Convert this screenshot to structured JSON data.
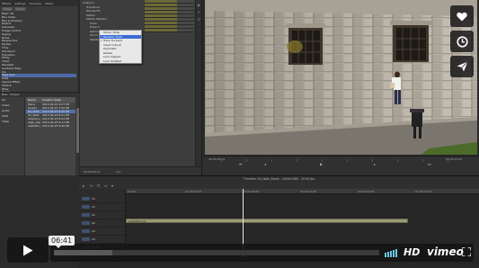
{
  "left_panel": {
    "tabs": [
      "Effects",
      "Settings",
      "Favorites",
      "Media"
    ],
    "search": [
      "Video",
      "Audio"
    ],
    "effects": [
      "Basic 3D",
      "Blur Video",
      "Blur & Sharpen",
      "Distort",
      "Generate",
      "Image Control",
      "Keying",
      "Noise",
      "Perspective",
      "Stylize",
      "Time",
      "Transform",
      "Transition",
      "Utility",
      "Video",
      "Obsolete",
      "Gradient Wipe",
      "Iris",
      "Page Peel",
      "Slide",
      "Special Effect",
      "Stretch",
      "Wipe",
      "Zoom",
      "Frame Blend",
      "Lumetri Presets",
      "Presets",
      "Film Stock",
      "Cinematic",
      "Desaturation",
      "Speed Looks",
      "Temperature",
      "Technical",
      "Color Correction",
      "Adjust",
      "Lens Distortion"
    ],
    "bins": {
      "tabs": [
        "Bins",
        "Project"
      ],
      "folders": [
        "All",
        "Video",
        "Audio",
        "Stills",
        "Titles"
      ],
      "columns": [
        "Name",
        "Creation Date"
      ],
      "rows": [
        {
          "name": "Piece",
          "date": "2013-04-23 4:27 PM"
        },
        {
          "name": "face01",
          "date": "2013-04-23 7:00 PM"
        },
        {
          "name": "04_Walk_Stone",
          "date": "2013-04-23 8:00 PM"
        },
        {
          "name": "05_Walk",
          "date": "2013-04-23 8:01 PM"
        },
        {
          "name": "Align01.png",
          "date": "2013-04-23 8:22 PM"
        },
        {
          "name": "align_step.png",
          "date": "2013-04-23 9:11 PM"
        },
        {
          "name": "walk001.png",
          "date": "2013-04-23 9:40 PM"
        }
      ]
    }
  },
  "fx_panel": {
    "tree": [
      "Video Fx",
      "Transform",
      "Handle Fix",
      "Motion",
      "Motion Markers",
      "Track",
      "Track 2",
      "Options",
      "Zoom",
      "Stabilize"
    ],
    "context_menu": [
      {
        "label": "Show / Hide",
        "checked": false,
        "highlight": false
      },
      {
        "label": "Rename Track",
        "checked": true,
        "highlight": true
      },
      {
        "label": "Track Forward",
        "checked": true,
        "highlight": false
      },
      {
        "label": "Insert Cutout",
        "checked": false,
        "highlight": false
      },
      {
        "label": "Duplicate",
        "checked": false,
        "highlight": false
      },
      {
        "label": "Delete",
        "checked": false,
        "highlight": false
      },
      {
        "label": "Lock Clipped",
        "checked": false,
        "highlight": false
      },
      {
        "label": "Lock Unlisted",
        "checked": false,
        "highlight": false
      }
    ],
    "bottom_time": "00:00:04:12",
    "bottom_zoom": "1/4"
  },
  "viewer": {
    "timecode_left": "00:00:04:12",
    "timecode_right": "00:00:10:02",
    "play_glyph": "▶"
  },
  "timeline": {
    "title": "Timeline: 04_Walk_Stone - 1920x1080 - 25.00 fps",
    "ruler": [
      "00:00",
      "00:00:03:00",
      "00:00:06:00",
      "00:00:09:00",
      "00:00:12:00",
      "00:00:15:00"
    ],
    "tracks": [
      "V2",
      "V1",
      "A1",
      "A2",
      "A3",
      "A4",
      "Master"
    ],
    "clip_label": "walk001.png"
  },
  "player": {
    "time": "06:41",
    "hd_label": "HD",
    "brand_label": "vimeo",
    "progress_fraction": 0.18
  }
}
